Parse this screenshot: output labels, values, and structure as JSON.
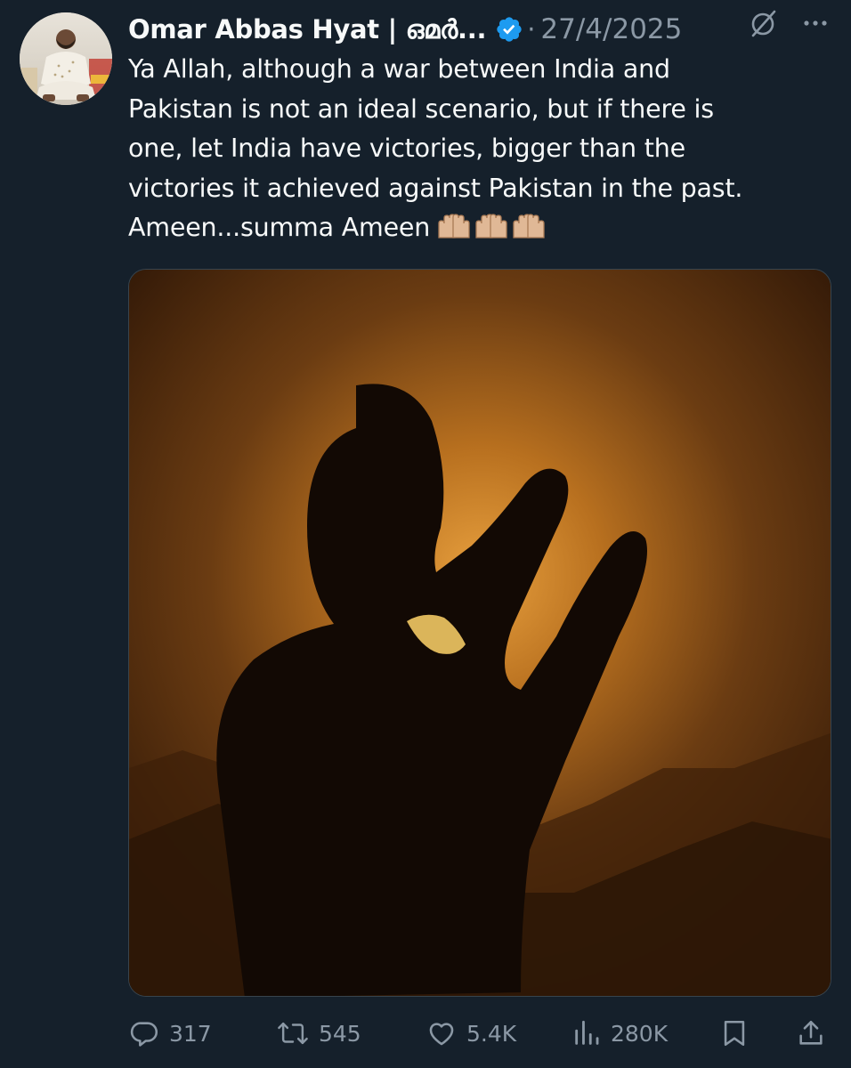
{
  "author": {
    "display_name": "Omar Abbas Hyat | ഒമർ...",
    "verified": true,
    "verified_color": "#1d9bf0"
  },
  "meta": {
    "separator": "·",
    "date": "27/4/2025"
  },
  "post": {
    "lines": [
      "Ya Allah, although a war between India and",
      "Pakistan is not an ideal scenario, but if there is",
      "one, let India have victories, bigger than the",
      "victories it achieved against Pakistan in the past.",
      "Ameen...summa Ameen"
    ],
    "emoji": [
      "palms-up-together-emoji",
      "palms-up-together-emoji",
      "palms-up-together-emoji"
    ]
  },
  "media": {
    "icon": "photo-silhouette-praying"
  },
  "stats": {
    "replies": "317",
    "reposts": "545",
    "likes": "5.4K",
    "views": "280K"
  },
  "colors": {
    "background": "#15202b",
    "text": "#f7f9f9",
    "muted": "#8b98a5",
    "accent": "#1d9bf0"
  }
}
